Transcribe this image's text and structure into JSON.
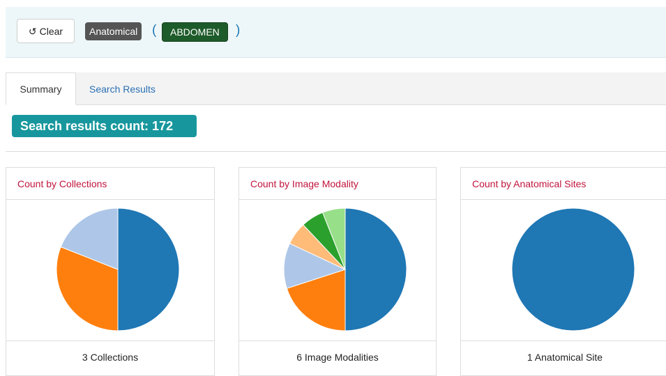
{
  "filter": {
    "clear_label": "Clear",
    "clear_icon": "undo-icon",
    "type_badge": "Anatomical",
    "open_paren": "(",
    "value_badge": "ABDOMEN",
    "close_paren": ")"
  },
  "tabs": [
    {
      "label": "Summary",
      "active": true
    },
    {
      "label": "Search Results",
      "active": false
    }
  ],
  "count_badge": "Search results count: 172",
  "panels": [
    {
      "title": "Count by Collections",
      "footer": "3 Collections"
    },
    {
      "title": "Count by Image Modality",
      "footer": "6 Image Modalities"
    },
    {
      "title": "Count by Anatomical Sites",
      "footer": "1 Anatomical Site"
    }
  ],
  "colors": {
    "accent_teal": "#17979d",
    "title_red": "#c0143c",
    "link_blue": "#2a6fb4",
    "badge_green": "#1e5b2a"
  },
  "chart_data": [
    {
      "type": "pie",
      "slices": [
        {
          "value": 50,
          "color": "#1f77b4"
        },
        {
          "value": 31,
          "color": "#ff7f0e"
        },
        {
          "value": 19,
          "color": "#aec7e8"
        }
      ]
    },
    {
      "type": "pie",
      "slices": [
        {
          "value": 50,
          "color": "#1f77b4"
        },
        {
          "value": 20,
          "color": "#ff7f0e"
        },
        {
          "value": 12,
          "color": "#aec7e8"
        },
        {
          "value": 6,
          "color": "#ffbb78"
        },
        {
          "value": 6,
          "color": "#2ca02c"
        },
        {
          "value": 6,
          "color": "#98df8a"
        }
      ]
    },
    {
      "type": "pie",
      "slices": [
        {
          "value": 100,
          "color": "#1f77b4"
        }
      ]
    }
  ]
}
